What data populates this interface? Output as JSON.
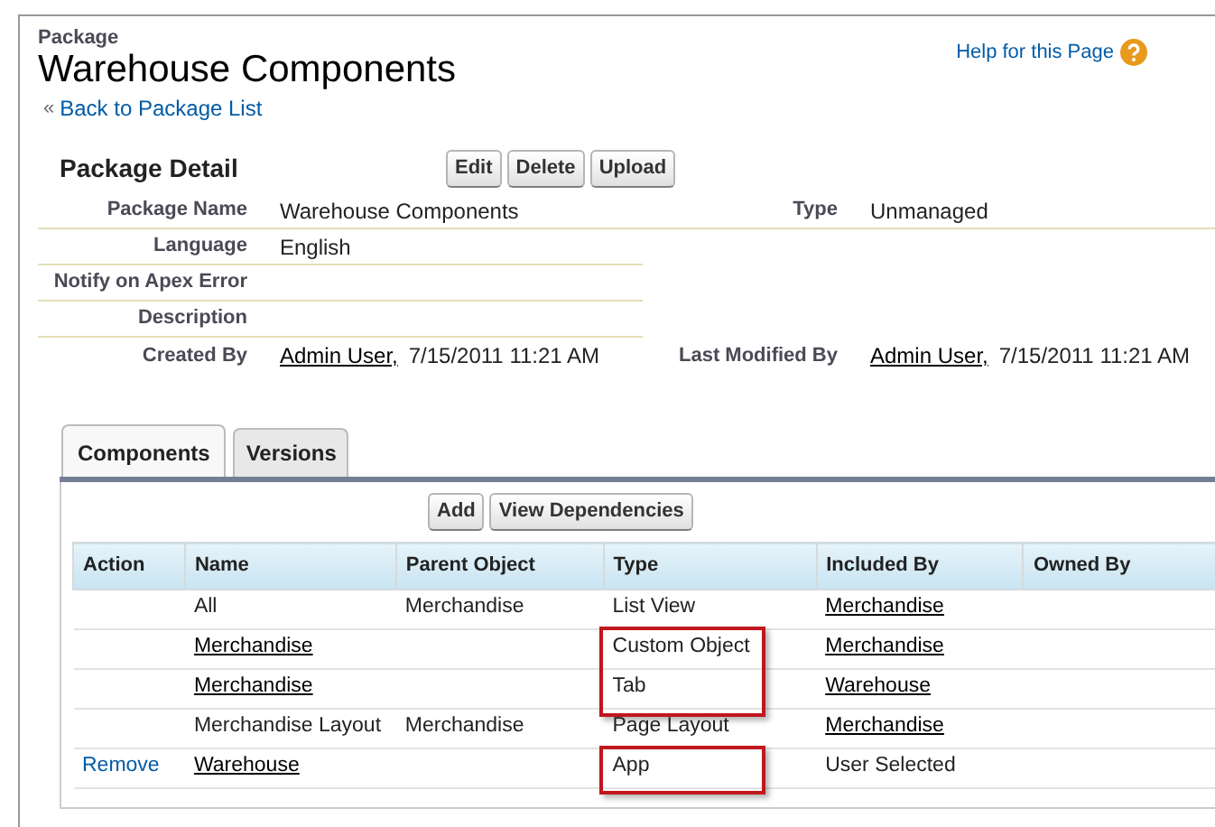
{
  "header": {
    "kicker": "Package",
    "title": "Warehouse Components",
    "back_link": "Back to Package List",
    "back_marker": "«",
    "help_link": "Help for this Page"
  },
  "detail": {
    "title": "Package Detail",
    "buttons": [
      "Edit",
      "Delete",
      "Upload"
    ],
    "rows": [
      {
        "left": {
          "label": "Package Name",
          "value": "Warehouse Components"
        },
        "right": {
          "label": "Type",
          "value": "Unmanaged"
        }
      },
      {
        "left": {
          "label": "Language",
          "value": "English"
        }
      },
      {
        "left": {
          "label": "Notify on Apex Error"
        }
      },
      {
        "left": {
          "label": "Description"
        }
      },
      {
        "left": {
          "label": "Created By",
          "link": "Admin User,",
          "value": "7/15/2011 11:21 AM"
        },
        "right": {
          "label": "Last Modified By",
          "link": "Admin User,",
          "value": "7/15/2011 11:21 AM"
        }
      }
    ]
  },
  "tabs": [
    {
      "label": "Components",
      "selected": true
    },
    {
      "label": "Versions",
      "selected": false
    }
  ],
  "components": {
    "buttons": [
      "Add",
      "View Dependencies"
    ],
    "columns": [
      "Action",
      "Name",
      "Parent Object",
      "Type",
      "Included By",
      "Owned By"
    ],
    "rows": [
      {
        "name": "All",
        "name_link": false,
        "parent": "Merchandise",
        "type": "List View",
        "included_by": "Merchandise",
        "included_link": true,
        "highlighted": false
      },
      {
        "name": "Merchandise",
        "name_link": true,
        "type": "Custom Object",
        "included_by": "Merchandise",
        "included_link": true,
        "highlighted": true
      },
      {
        "name": "Merchandise",
        "name_link": true,
        "type": "Tab",
        "included_by": "Warehouse",
        "included_link": true,
        "highlighted": true
      },
      {
        "name": "Merchandise Layout",
        "name_link": false,
        "parent": "Merchandise",
        "type": "Page Layout",
        "included_by": "Merchandise",
        "included_link": true,
        "highlighted": false
      },
      {
        "action": "Remove",
        "name": "Warehouse",
        "name_link": true,
        "type": "App",
        "included_by": "User Selected",
        "included_link": false,
        "highlighted": true
      }
    ]
  }
}
